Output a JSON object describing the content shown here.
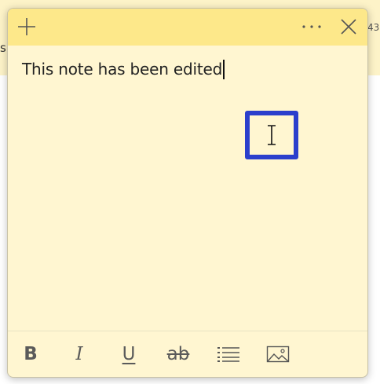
{
  "background": {
    "left_fragment": "s",
    "right_fragment": "43"
  },
  "note": {
    "header": {
      "add_icon": "plus-icon",
      "menu_icon": "more-horizontal-icon",
      "close_icon": "close-icon",
      "color": "#fde88a"
    },
    "body_text": "This note has been edited",
    "body_color": "#fff6d1",
    "highlight_color": "#2b3fcc",
    "toolbar": {
      "bold_label": "B",
      "italic_label": "I",
      "underline_label": "U",
      "strikethrough_label": "ab",
      "list_icon": "bullet-list-icon",
      "image_icon": "image-icon"
    }
  }
}
